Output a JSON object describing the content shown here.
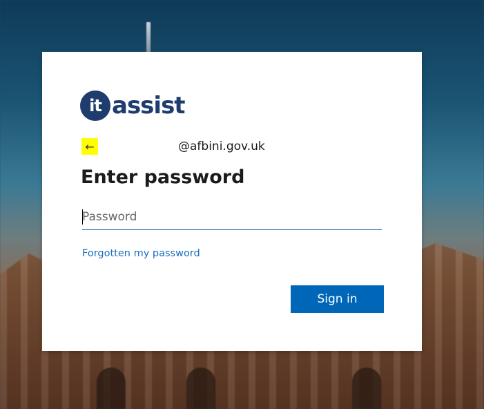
{
  "brand": {
    "logo_circle_text": "it",
    "logo_word": "assist"
  },
  "identity": {
    "back_icon": "←",
    "email_domain": "@afbini.gov.uk"
  },
  "heading": "Enter password",
  "password_field": {
    "placeholder": "Password",
    "value": ""
  },
  "links": {
    "forgot": "Forgotten my password"
  },
  "buttons": {
    "sign_in": "Sign in"
  },
  "colors": {
    "accent": "#0067b8",
    "link": "#1a6dc2",
    "logo": "#1e3d6e",
    "back_highlight": "#ffff00"
  }
}
